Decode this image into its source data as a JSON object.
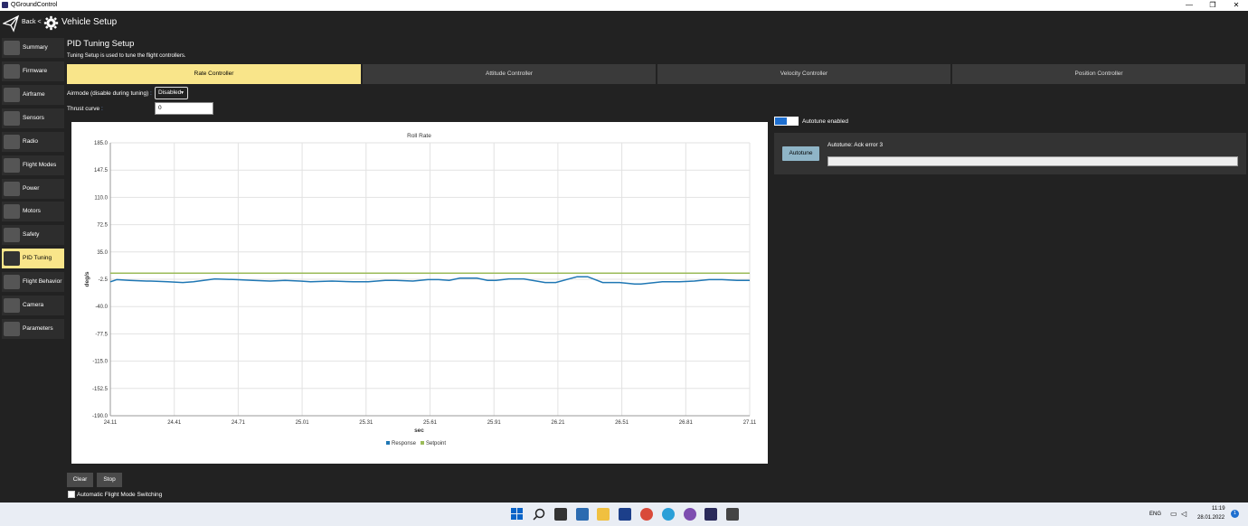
{
  "window": {
    "title": "QGroundControl",
    "minimize": "—",
    "maximize": "❐",
    "close": "✕"
  },
  "toolbar": {
    "back_label": "Back <",
    "title": "Vehicle Setup"
  },
  "sidebar": {
    "items": [
      {
        "label": "Summary",
        "icon": "plane-icon"
      },
      {
        "label": "Firmware",
        "icon": "firmware-icon"
      },
      {
        "label": "Airframe",
        "icon": "airframe-icon"
      },
      {
        "label": "Sensors",
        "icon": "sensors-icon"
      },
      {
        "label": "Radio",
        "icon": "radio-icon"
      },
      {
        "label": "Flight Modes",
        "icon": "flight-modes-icon"
      },
      {
        "label": "Power",
        "icon": "power-icon"
      },
      {
        "label": "Motors",
        "icon": "motors-icon"
      },
      {
        "label": "Safety",
        "icon": "safety-icon"
      },
      {
        "label": "PID Tuning",
        "icon": "pid-tuning-icon"
      },
      {
        "label": "Flight Behavior",
        "icon": "flight-behavior-icon"
      },
      {
        "label": "Camera",
        "icon": "camera-icon"
      },
      {
        "label": "Parameters",
        "icon": "parameters-icon"
      }
    ],
    "active_index": 9
  },
  "page": {
    "title": "PID Tuning Setup",
    "subtitle": "Tuning Setup is used to tune the flight controllers."
  },
  "tabs": [
    {
      "label": "Rate Controller",
      "active": true
    },
    {
      "label": "Attitude Controller",
      "active": false
    },
    {
      "label": "Velocity Controller",
      "active": false
    },
    {
      "label": "Position Controller",
      "active": false
    }
  ],
  "airmode": {
    "label": "Airmode (disable during tuning)",
    "colon": ":",
    "value": "Disabled"
  },
  "thrust": {
    "label": "Thrust curve",
    "colon": ":",
    "value": "0"
  },
  "autotune": {
    "toggle_label": "Autotune enabled",
    "enabled": true,
    "button_label": "Autotune",
    "status": "Autotune: Ack error 3",
    "progress": 0
  },
  "buttons": {
    "clear": "Clear",
    "stop": "Stop"
  },
  "auto_flight_mode_switching": {
    "label": "Automatic Flight Mode Switching",
    "checked": false
  },
  "taskbar": {
    "lang": "ENG",
    "time": "11:19",
    "date": "28.01.2022",
    "notifications": "1"
  },
  "chart_data": {
    "type": "line",
    "title": "Roll Rate",
    "xlabel": "sec",
    "ylabel": "deg/s",
    "xlim": [
      24.11,
      27.11
    ],
    "ylim": [
      -190.0,
      185.0
    ],
    "x_ticks": [
      "24.11",
      "24.41",
      "24.71",
      "25.01",
      "25.31",
      "25.61",
      "25.91",
      "26.21",
      "26.51",
      "26.81",
      "27.11"
    ],
    "y_ticks": [
      "185.0",
      "147.5",
      "110.0",
      "72.5",
      "35.0",
      "-2.5",
      "-40.0",
      "-77.5",
      "-115.0",
      "-152.5",
      "-190.0"
    ],
    "grid": true,
    "legend_position": "bottom-center",
    "series": [
      {
        "name": "Response",
        "color": "#1f77b4",
        "x": [
          24.11,
          24.14,
          24.2,
          24.28,
          24.3,
          24.38,
          24.45,
          24.5,
          24.6,
          24.7,
          24.78,
          24.86,
          24.93,
          25.0,
          25.05,
          25.15,
          25.25,
          25.32,
          25.4,
          25.45,
          25.53,
          25.6,
          25.65,
          25.7,
          25.75,
          25.83,
          25.88,
          25.92,
          25.98,
          26.05,
          26.15,
          26.2,
          26.3,
          26.35,
          26.42,
          26.5,
          26.57,
          26.6,
          26.7,
          26.78,
          26.85,
          26.92,
          26.98,
          27.05,
          27.11
        ],
        "y": [
          -6,
          -3,
          -4,
          -5,
          -5,
          -6,
          -7,
          -6,
          -2,
          -3,
          -4,
          -5,
          -4,
          -5,
          -6,
          -5,
          -6,
          -6,
          -4,
          -4,
          -5,
          -3,
          -3,
          -4,
          -1,
          -1,
          -4,
          -4,
          -2,
          -2,
          -7,
          -7,
          1,
          1,
          -7,
          -7,
          -9,
          -9,
          -6,
          -6,
          -5,
          -3,
          -3,
          -4,
          -4
        ]
      },
      {
        "name": "Setpoint",
        "color": "#9bbb59",
        "x": [
          24.11,
          27.11
        ],
        "y": [
          6,
          6
        ]
      }
    ]
  }
}
